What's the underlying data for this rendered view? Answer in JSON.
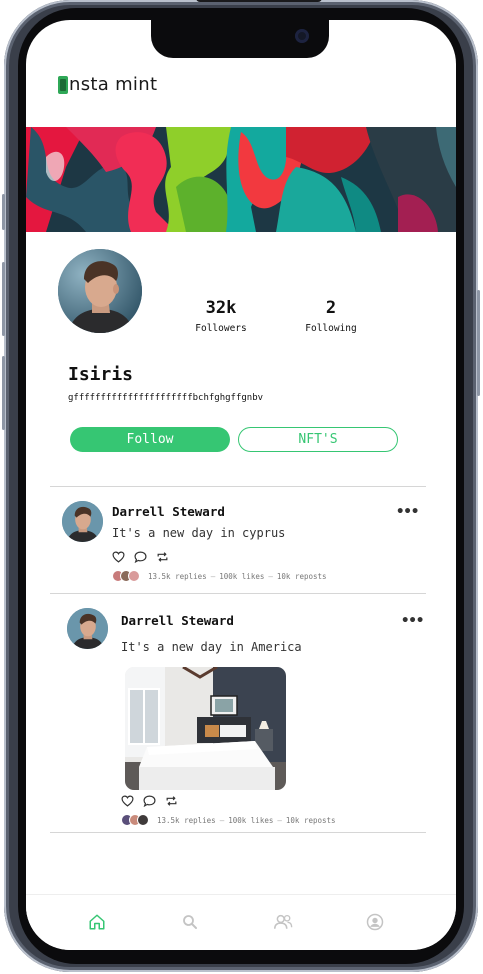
{
  "app": {
    "logo_text": "nsta mint"
  },
  "profile": {
    "name": "Isiris",
    "handle": "gffffffffffffffffffffffbchfghgffgnbv",
    "followers_count": "32k",
    "followers_label": "Followers",
    "following_count": "2",
    "following_label": "Following"
  },
  "buttons": {
    "follow": "Follow",
    "nfts": "NFT'S"
  },
  "posts": [
    {
      "author": "Darrell Steward",
      "text": "It's a new day in cyprus",
      "replies": "13.5k replies",
      "likes": "100k likes",
      "reposts": "10k reposts"
    },
    {
      "author": "Darrell Steward",
      "text": "It's a new day in America",
      "replies": "13.5k replies",
      "likes": "100k likes",
      "reposts": "10k reposts"
    }
  ],
  "nav": [
    "home-icon",
    "search-icon",
    "users-icon",
    "profile-icon"
  ],
  "colors": {
    "accent": "#36c673",
    "text": "#111111",
    "divider": "#d6d6d6"
  }
}
